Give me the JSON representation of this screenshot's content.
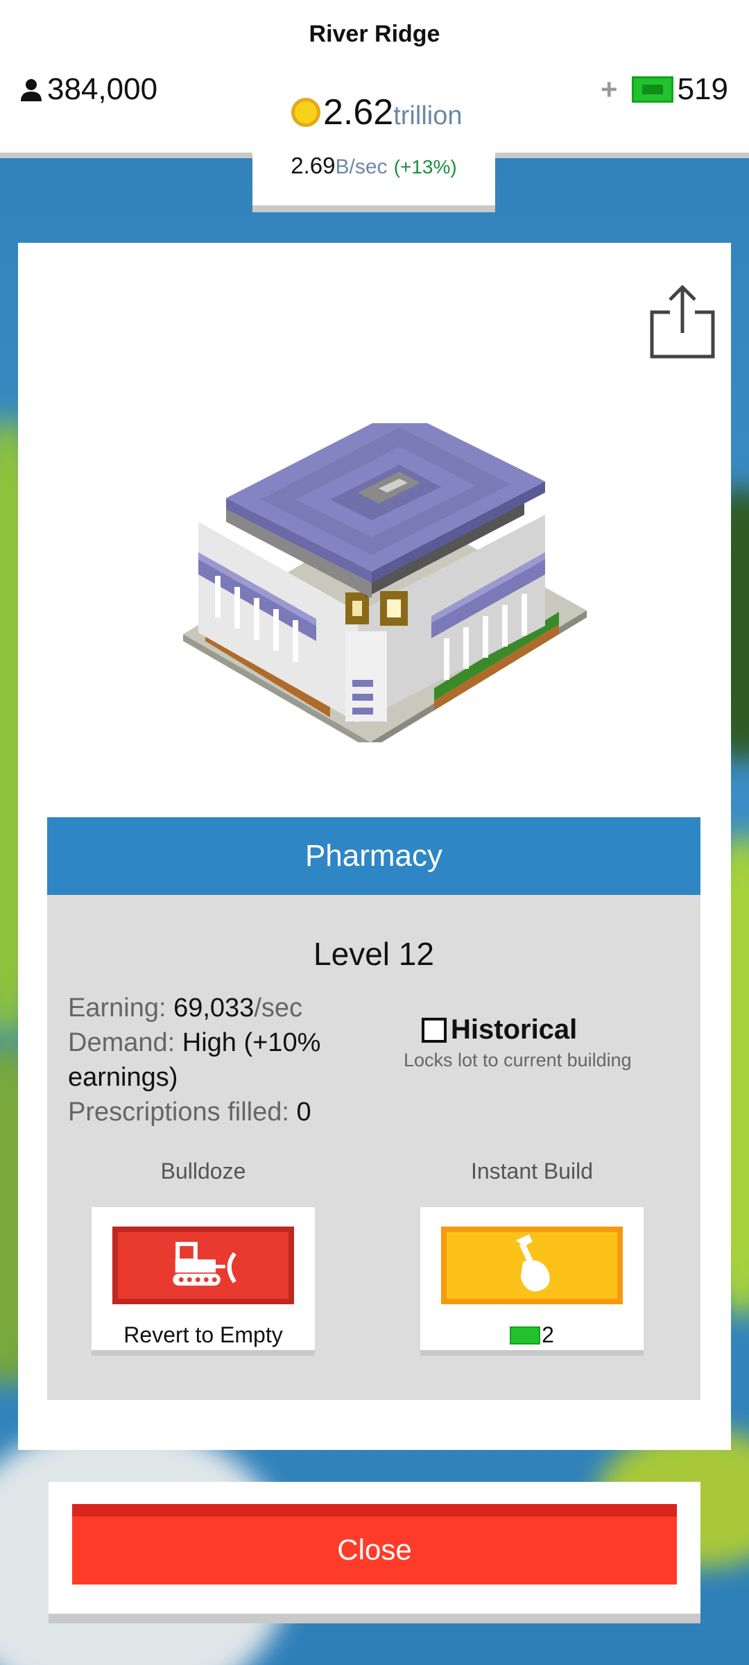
{
  "header": {
    "city_name": "River Ridge",
    "population": "384,000",
    "money_value": "2.62",
    "money_unit": "trillion",
    "income_value": "2.69",
    "income_unit": "B/sec",
    "income_change": "(+13%)",
    "gems_plus": "+",
    "gems_count": "519"
  },
  "building": {
    "name": "Pharmacy",
    "level": "Level 12",
    "earning_label": "Earning: ",
    "earning_value": "69,033",
    "earning_unit": "/sec",
    "demand_label": "Demand: ",
    "demand_value": "High (+10% earnings)",
    "filled_label": "Prescriptions filled: ",
    "filled_value": "0",
    "historical_label": "Historical",
    "historical_sub": "Locks lot to current building",
    "historical_checked": false
  },
  "actions": {
    "bulldoze_label": "Bulldoze",
    "bulldoze_caption": "Revert to Empty",
    "instant_label": "Instant Build",
    "instant_cost": "2"
  },
  "footer": {
    "close_label": "Close"
  },
  "icons": {
    "population": "person-icon",
    "money": "coin-icon",
    "gems": "gem-bill-icon",
    "share": "share-icon",
    "bulldoze": "bulldozer-icon",
    "instant_build": "hammer-hand-icon"
  },
  "colors": {
    "header_blue": "#2f86c4",
    "bulldoze_red": "#e93a30",
    "instant_yellow": "#fcc21a",
    "close_red": "#ff3b2a",
    "gem_green": "#22c22e"
  }
}
